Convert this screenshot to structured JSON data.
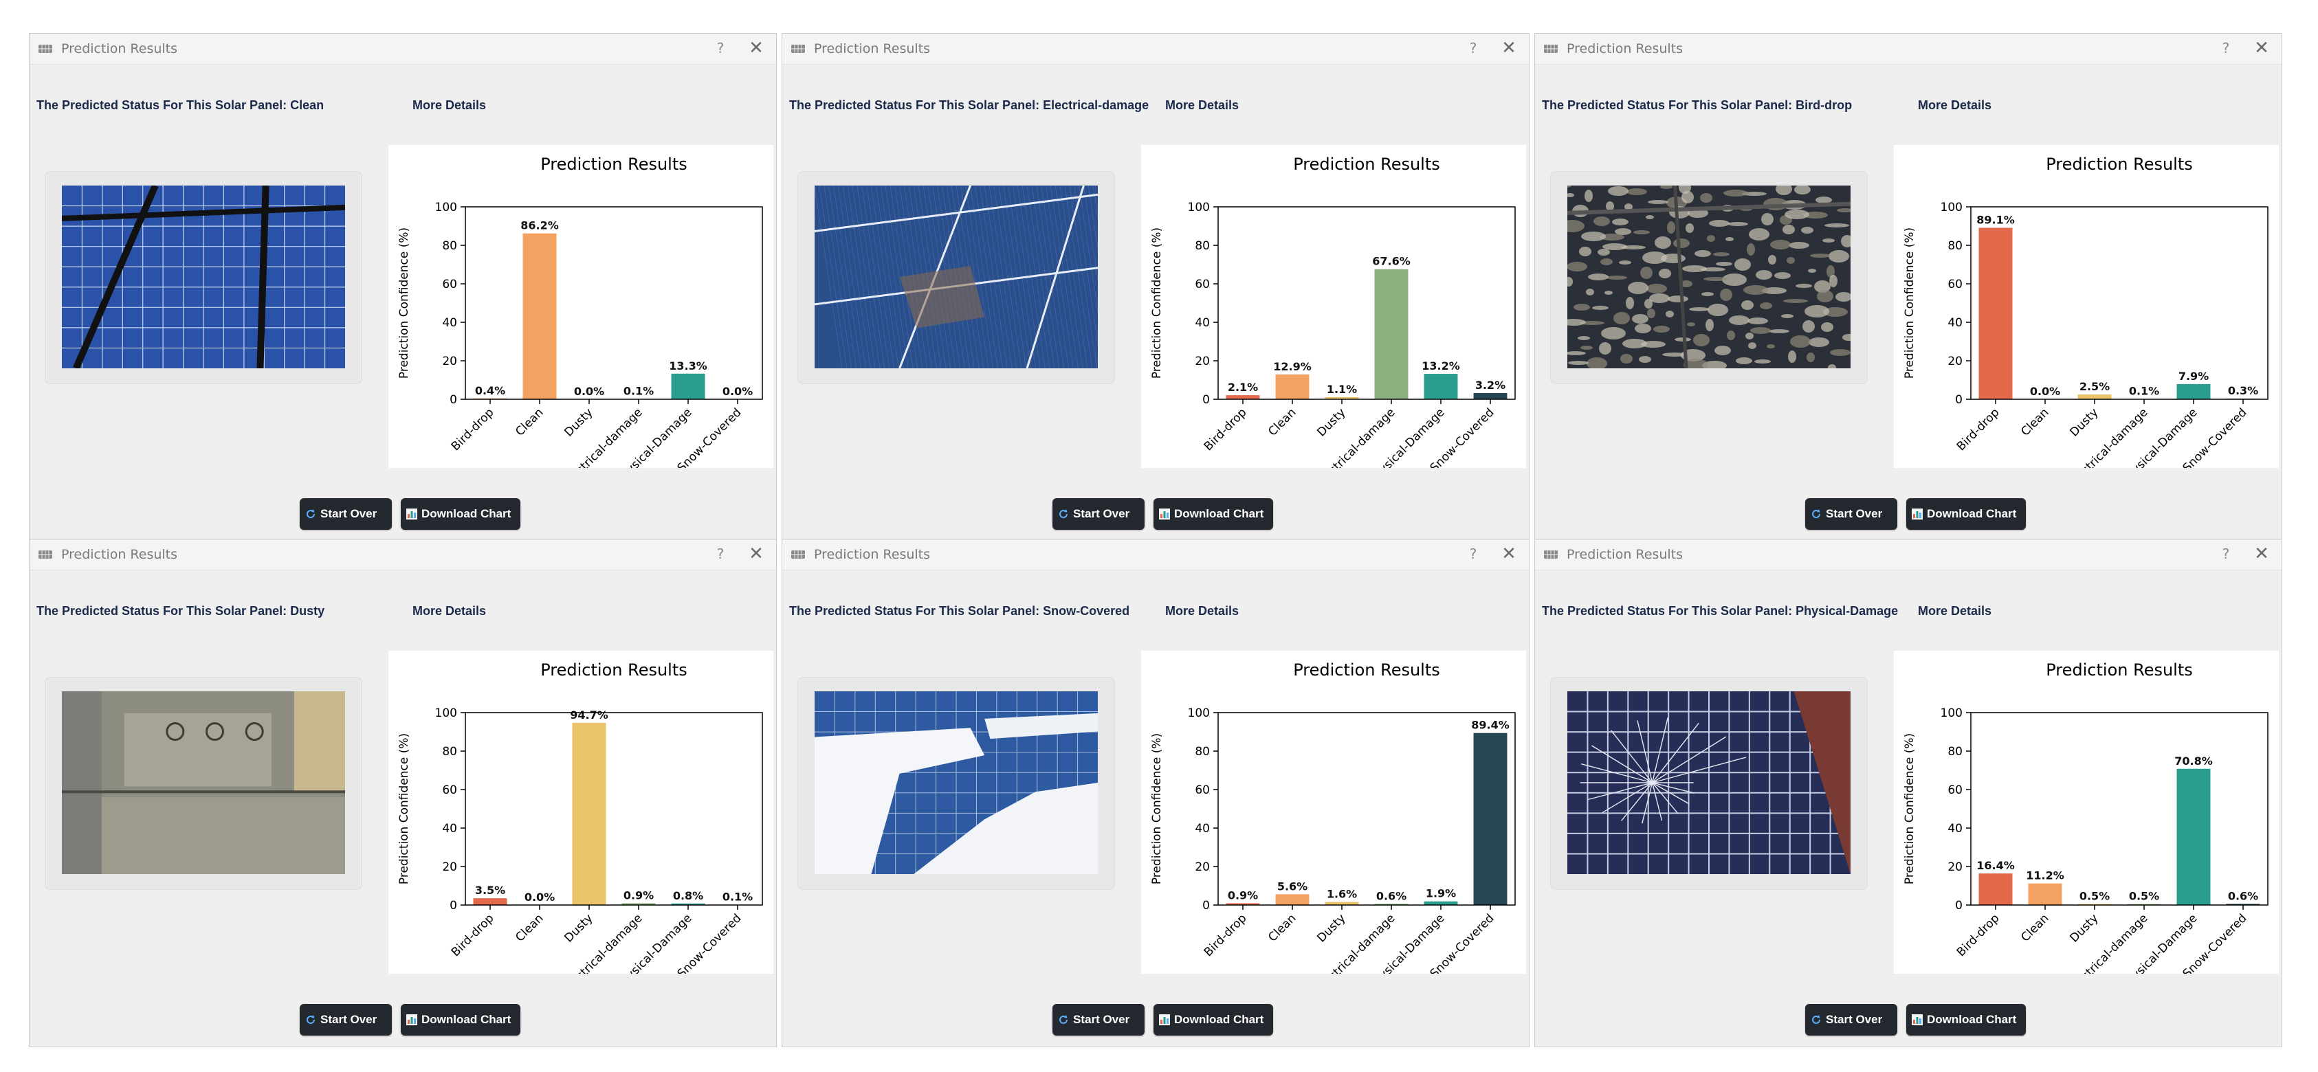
{
  "accent_colors": {
    "Bird-drop": "#e4694a",
    "Clean": "#f4a261",
    "Dusty": "#e9c46a",
    "Electrical-damage": "#8ab17d",
    "Physical-Damage": "#2a9d8f",
    "Snow-Covered": "#264653"
  },
  "windows": [
    {
      "title": "Prediction Results",
      "help": "?",
      "close": "✕",
      "status_prefix": "The Predicted Status For This Solar Panel:",
      "status_value": "Clean",
      "more_details": "More Details",
      "start_over": "Start Over",
      "download_chart": "Download Chart",
      "photo_icon": "solar-panel-clean-photo",
      "chart_data": {
        "type": "bar",
        "title": "Prediction Results",
        "ylabel": "Prediction Confidence (%)",
        "ylim": [
          0,
          100
        ],
        "yticks": [
          "0",
          "20",
          "40",
          "60",
          "80",
          "100"
        ],
        "categories": [
          "Bird-drop",
          "Clean",
          "Dusty",
          "Electrical-damage",
          "Physical-Damage",
          "Snow-Covered"
        ],
        "values": [
          0.4,
          86.2,
          0.0,
          0.1,
          13.3,
          0.0
        ],
        "data_labels": [
          "0.4%",
          "86.2%",
          "0.0%",
          "0.1%",
          "13.3%",
          "0.0%"
        ]
      }
    },
    {
      "title": "Prediction Results",
      "help": "?",
      "close": "✕",
      "status_prefix": "The Predicted Status For This Solar Panel:",
      "status_value": "Electrical-damage",
      "more_details": "More Details",
      "start_over": "Start Over",
      "download_chart": "Download Chart",
      "photo_icon": "solar-panel-electrical-damage-photo",
      "chart_data": {
        "type": "bar",
        "title": "Prediction Results",
        "ylabel": "Prediction Confidence (%)",
        "ylim": [
          0,
          100
        ],
        "yticks": [
          "0",
          "20",
          "40",
          "60",
          "80",
          "100"
        ],
        "categories": [
          "Bird-drop",
          "Clean",
          "Dusty",
          "Electrical-damage",
          "Physical-Damage",
          "Snow-Covered"
        ],
        "values": [
          2.1,
          12.9,
          1.1,
          67.6,
          13.2,
          3.2
        ],
        "data_labels": [
          "2.1%",
          "12.9%",
          "1.1%",
          "67.6%",
          "13.2%",
          "3.2%"
        ]
      }
    },
    {
      "title": "Prediction Results",
      "help": "?",
      "close": "✕",
      "status_prefix": "The Predicted Status For This Solar Panel:",
      "status_value": "Bird-drop",
      "more_details": "More Details",
      "start_over": "Start Over",
      "download_chart": "Download Chart",
      "photo_icon": "solar-panel-bird-drop-photo",
      "chart_data": {
        "type": "bar",
        "title": "Prediction Results",
        "ylabel": "Prediction Confidence (%)",
        "ylim": [
          0,
          100
        ],
        "yticks": [
          "0",
          "20",
          "40",
          "60",
          "80",
          "100"
        ],
        "categories": [
          "Bird-drop",
          "Clean",
          "Dusty",
          "Electrical-damage",
          "Physical-Damage",
          "Snow-Covered"
        ],
        "values": [
          89.1,
          0.0,
          2.5,
          0.1,
          7.9,
          0.3
        ],
        "data_labels": [
          "89.1%",
          "0.0%",
          "2.5%",
          "0.1%",
          "7.9%",
          "0.3%"
        ]
      }
    },
    {
      "title": "Prediction Results",
      "help": "?",
      "close": "✕",
      "status_prefix": "The Predicted Status For This Solar Panel:",
      "status_value": "Dusty",
      "more_details": "More Details",
      "start_over": "Start Over",
      "download_chart": "Download Chart",
      "photo_icon": "solar-panel-dusty-photo",
      "chart_data": {
        "type": "bar",
        "title": "Prediction Results",
        "ylabel": "Prediction Confidence (%)",
        "ylim": [
          0,
          100
        ],
        "yticks": [
          "0",
          "20",
          "40",
          "60",
          "80",
          "100"
        ],
        "categories": [
          "Bird-drop",
          "Clean",
          "Dusty",
          "Electrical-damage",
          "Physical-Damage",
          "Snow-Covered"
        ],
        "values": [
          3.5,
          0.0,
          94.7,
          0.9,
          0.8,
          0.1
        ],
        "data_labels": [
          "3.5%",
          "0.0%",
          "94.7%",
          "0.9%",
          "0.8%",
          "0.1%"
        ]
      }
    },
    {
      "title": "Prediction Results",
      "help": "?",
      "close": "✕",
      "status_prefix": "The Predicted Status For This Solar Panel:",
      "status_value": "Snow-Covered",
      "more_details": "More Details",
      "start_over": "Start Over",
      "download_chart": "Download Chart",
      "photo_icon": "solar-panel-snow-covered-photo",
      "chart_data": {
        "type": "bar",
        "title": "Prediction Results",
        "ylabel": "Prediction Confidence (%)",
        "ylim": [
          0,
          100
        ],
        "yticks": [
          "0",
          "20",
          "40",
          "60",
          "80",
          "100"
        ],
        "categories": [
          "Bird-drop",
          "Clean",
          "Dusty",
          "Electrical-damage",
          "Physical-Damage",
          "Snow-Covered"
        ],
        "values": [
          0.9,
          5.6,
          1.6,
          0.6,
          1.9,
          89.4
        ],
        "data_labels": [
          "0.9%",
          "5.6%",
          "1.6%",
          "0.6%",
          "1.9%",
          "89.4%"
        ]
      }
    },
    {
      "title": "Prediction Results",
      "help": "?",
      "close": "✕",
      "status_prefix": "The Predicted Status For This Solar Panel:",
      "status_value": "Physical-Damage",
      "more_details": "More Details",
      "start_over": "Start Over",
      "download_chart": "Download Chart",
      "photo_icon": "solar-panel-physical-damage-photo",
      "chart_data": {
        "type": "bar",
        "title": "Prediction Results",
        "ylabel": "Prediction Confidence (%)",
        "ylim": [
          0,
          100
        ],
        "yticks": [
          "0",
          "20",
          "40",
          "60",
          "80",
          "100"
        ],
        "categories": [
          "Bird-drop",
          "Clean",
          "Dusty",
          "Electrical-damage",
          "Physical-Damage",
          "Snow-Covered"
        ],
        "values": [
          16.4,
          11.2,
          0.5,
          0.5,
          70.8,
          0.6
        ],
        "data_labels": [
          "16.4%",
          "11.2%",
          "0.5%",
          "0.5%",
          "70.8%",
          "0.6%"
        ]
      }
    }
  ]
}
